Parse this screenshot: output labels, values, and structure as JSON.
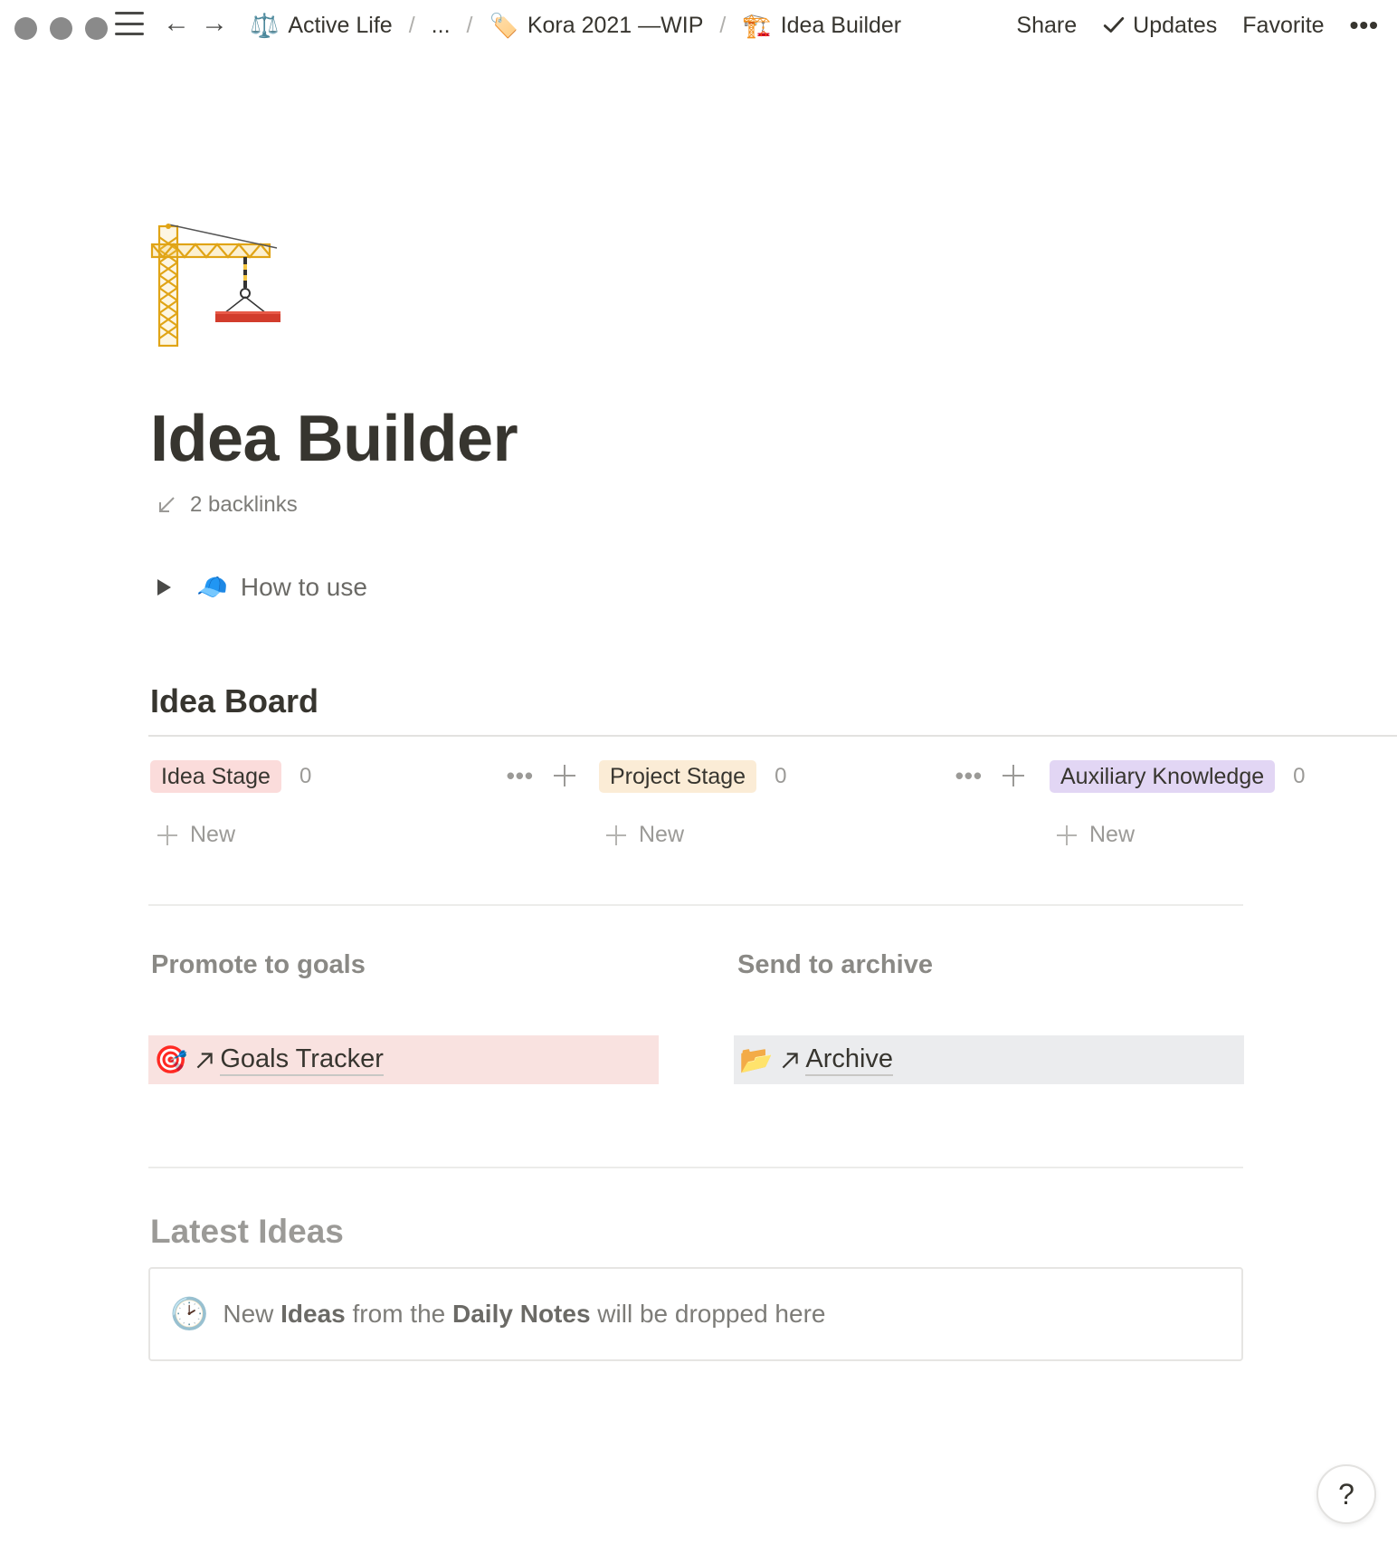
{
  "breadcrumb": [
    {
      "icon": "⚖️",
      "label": "Active Life"
    },
    {
      "label": "..."
    },
    {
      "icon": "🏷️",
      "label": "Kora 2021 —WIP"
    },
    {
      "icon": "🏗️",
      "label": "Idea Builder"
    }
  ],
  "actions": {
    "share": "Share",
    "updates": "Updates",
    "favorite": "Favorite",
    "more": "•••"
  },
  "page": {
    "icon": "crane-icon",
    "title": "Idea Builder",
    "backlinks": "2 backlinks"
  },
  "toggle": {
    "icon": "🧢",
    "label": "How to use"
  },
  "board": {
    "title": "Idea Board",
    "columns": [
      {
        "label": "Idea Stage",
        "count": "0",
        "color": "#fbdcdb",
        "new_label": "New"
      },
      {
        "label": "Project Stage",
        "count": "0",
        "color": "#fbecd6",
        "new_label": "New"
      },
      {
        "label": "Auxiliary Knowledge",
        "count": "0",
        "color": "#e2d6f4",
        "new_label": "New"
      }
    ],
    "tools_more": "•••"
  },
  "links": {
    "promote_heading": "Promote to goals",
    "archive_heading": "Send to archive",
    "goals": {
      "icon": "🎯",
      "label": "Goals Tracker"
    },
    "archive": {
      "icon": "📂",
      "label": "Archive"
    }
  },
  "latest": {
    "title": "Latest Ideas",
    "callout_icon": "🕑",
    "callout_parts": [
      "New ",
      "Ideas",
      " from the ",
      "Daily Notes",
      " will be dropped here"
    ]
  },
  "help_label": "?"
}
